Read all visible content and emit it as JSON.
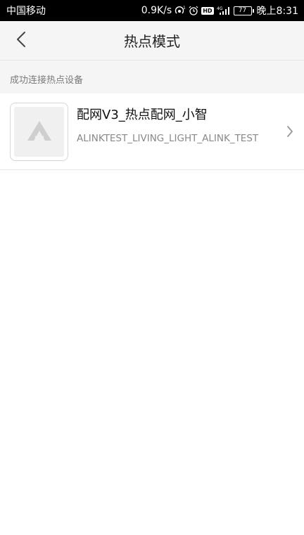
{
  "status_bar": {
    "carrier": "中国移动",
    "speed": "0.9K/s",
    "battery_level": "77",
    "time": "晚上8:31",
    "icons": [
      "wifi-hotspot-icon",
      "alarm-icon",
      "hd-icon",
      "signal-4g-icon",
      "battery-icon"
    ],
    "hd_badge": "HD"
  },
  "nav": {
    "back_icon": "chevron-left-icon",
    "title": "热点模式"
  },
  "section": {
    "header": "成功连接热点设备"
  },
  "devices": [
    {
      "name": "配网V3_热点配网_小智",
      "model": "ALINKTEST_LIVING_LIGHT_ALINK_TEST",
      "thumbnail_icon": "alink-logo-icon",
      "chevron_icon": "chevron-right-icon"
    }
  ],
  "colors": {
    "status_bar_bg": "#000000",
    "nav_bg": "#f5f5f5",
    "section_bg": "#f5f5f5",
    "secondary_text": "#888888"
  }
}
